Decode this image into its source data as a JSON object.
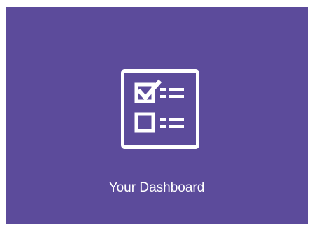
{
  "tile": {
    "label": "Your Dashboard",
    "icon": "checklist-icon",
    "background_color": "#5c4b9b",
    "foreground_color": "#ffffff"
  }
}
